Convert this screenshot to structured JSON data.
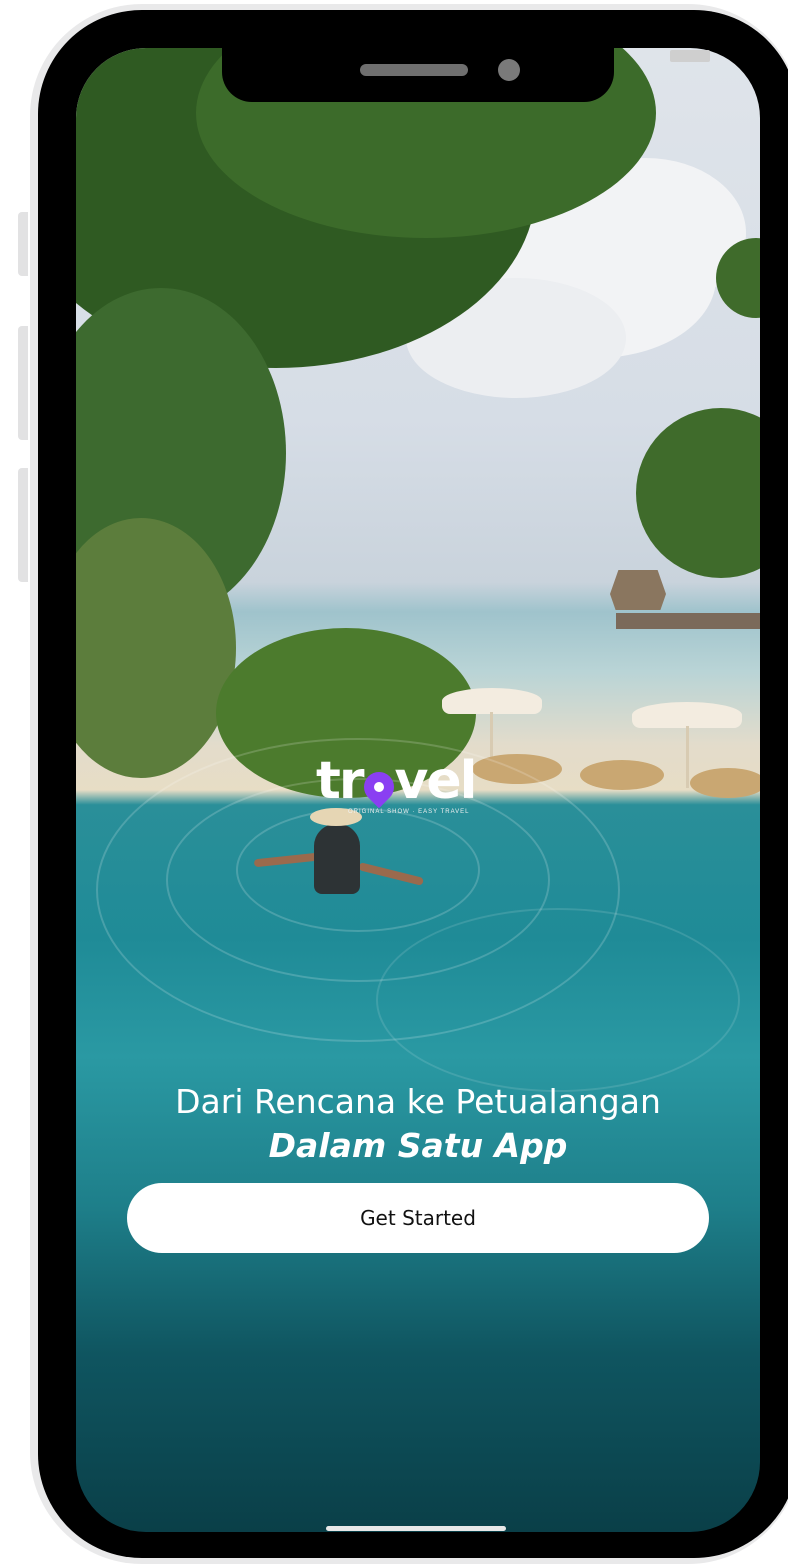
{
  "app": {
    "logo_text_before": "tr",
    "logo_text_after": "vel",
    "logo_pin_icon": "map-pin-icon",
    "logo_tagline": "ORIGINAL SHOW · EASY TRAVEL",
    "brand_color": "#8a3ff2"
  },
  "onboarding": {
    "headline_line1": "Dari Rencana ke Petualangan",
    "headline_line2": "Dalam Satu App",
    "cta_label": "Get Started",
    "background_image": "tropical-infinity-pool-photo"
  }
}
